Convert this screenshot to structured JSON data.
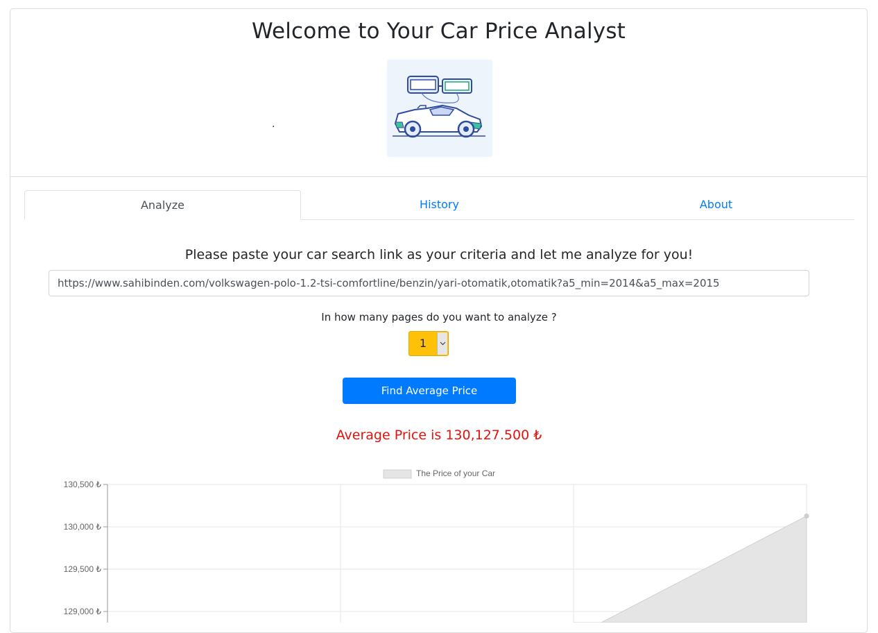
{
  "header": {
    "title": "Welcome to Your Car Price Analyst",
    "dot": "."
  },
  "tabs": [
    {
      "label": "Analyze",
      "active": true
    },
    {
      "label": "History",
      "active": false
    },
    {
      "label": "About",
      "active": false
    }
  ],
  "form": {
    "prompt": "Please paste your car search link as your criteria and let me analyze for you!",
    "url_value": "https://www.sahibinden.com/volkswagen-polo-1.2-tsi-comfortline/benzin/yari-otomatik,otomatik?a5_min=2014&a5_max=2015",
    "pages_label": "In how many pages do you want to analyze ?",
    "pages_selected": "1",
    "submit_label": "Find Average Price"
  },
  "result": {
    "text": "Average Price is 130,127.500 ₺",
    "color": "#e3120b"
  },
  "colors": {
    "accent": "#007bff",
    "select_bg": "#ffc107"
  },
  "chart_data": {
    "type": "area",
    "legend": [
      "The Price of your Car"
    ],
    "legend_position": "top",
    "y_ticks": [
      "130,500 ₺",
      "130,000 ₺",
      "129,500 ₺",
      "129,000 ₺"
    ],
    "y_tick_values": [
      130500,
      130000,
      129500,
      129000
    ],
    "x_count": 4,
    "series": [
      {
        "name": "The Price of your Car",
        "values": [
          null,
          null,
          128700,
          130127.5
        ]
      }
    ],
    "grid": true,
    "fill_color": "#e5e5e5",
    "line_color": "#d0d0d0"
  }
}
